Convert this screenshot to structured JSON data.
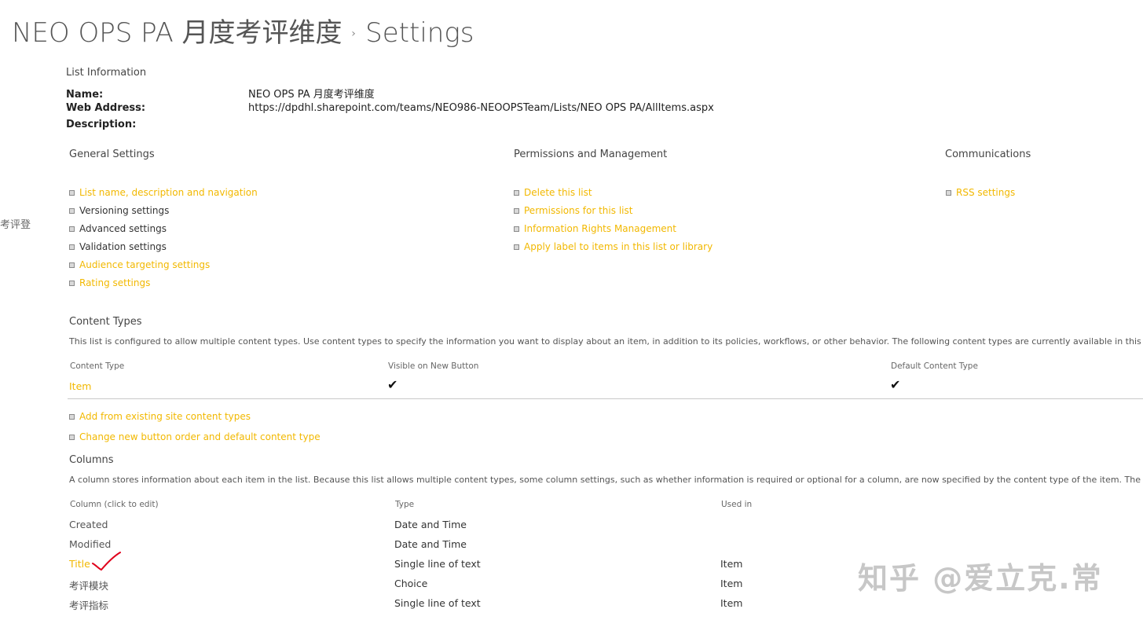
{
  "header": {
    "site_title": "NEO OPS PA 月度考评维度",
    "separator": "›",
    "page_name": "Settings"
  },
  "left_nav_fragment": "考评登",
  "list_information": {
    "heading": "List Information",
    "name_label": "Name:",
    "name_value": "NEO OPS PA 月度考评维度",
    "web_address_label": "Web Address:",
    "web_address_value": "https://dpdhl.sharepoint.com/teams/NEO986-NEOOPSTeam/Lists/NEO OPS PA/AllItems.aspx",
    "description_label": "Description:"
  },
  "general_settings": {
    "heading": "General Settings",
    "items": [
      {
        "label": "List name, description and navigation",
        "style": "link"
      },
      {
        "label": "Versioning settings",
        "style": "plain"
      },
      {
        "label": "Advanced settings",
        "style": "plain"
      },
      {
        "label": "Validation settings",
        "style": "plain"
      },
      {
        "label": "Audience targeting settings",
        "style": "link"
      },
      {
        "label": "Rating settings",
        "style": "link"
      }
    ]
  },
  "permissions": {
    "heading": "Permissions and Management",
    "items": [
      {
        "label": "Delete this list"
      },
      {
        "label": "Permissions for this list"
      },
      {
        "label": "Information Rights Management"
      },
      {
        "label": "Apply label to items in this list or library"
      }
    ]
  },
  "communications": {
    "heading": "Communications",
    "items": [
      {
        "label": "RSS settings"
      }
    ]
  },
  "content_types": {
    "heading": "Content Types",
    "description": "This list is configured to allow multiple content types. Use content types to specify the information you want to display about an item, in addition to its policies, workflows, or other behavior. The following content types are currently available in this list:",
    "columns": [
      "Content Type",
      "Visible on New Button",
      "Default Content Type"
    ],
    "rows": [
      {
        "name": "Item",
        "visible": true,
        "default": true
      }
    ],
    "actions": [
      "Add from existing site content types",
      "Change new button order and default content type"
    ]
  },
  "columns_section": {
    "heading": "Columns",
    "description": "A column stores information about each item in the list. Because this list allows multiple content types, some column settings, such as whether information is required or optional for a column, are now specified by the content type of the item. The following columns",
    "headers": [
      "Column (click to edit)",
      "Type",
      "Used in"
    ],
    "rows": [
      {
        "name": "Created",
        "type": "Date and Time",
        "used_in": ""
      },
      {
        "name": "Modified",
        "type": "Date and Time",
        "used_in": ""
      },
      {
        "name": "Title",
        "type": "Single line of text",
        "used_in": "Item"
      },
      {
        "name": "考评模块",
        "type": "Choice",
        "used_in": "Item"
      },
      {
        "name": "考评指标",
        "type": "Single line of text",
        "used_in": "Item"
      }
    ]
  },
  "watermark": "知乎 @爱立克.常",
  "colors": {
    "link": "#f2b800",
    "annotation": "#e0001b"
  }
}
